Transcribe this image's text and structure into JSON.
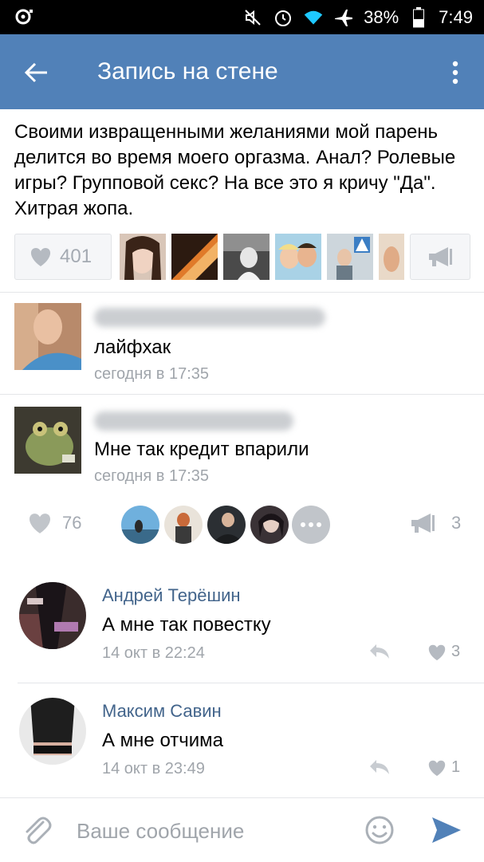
{
  "status_bar": {
    "battery": "38%",
    "time": "7:49"
  },
  "app_bar": {
    "title": "Запись на стене"
  },
  "post": {
    "text": "Своими извращенными желаниями мой парень делится во время моего оргазма. Анал? Ролевые игры? Групповой секс? На все это я кричу \"Да\". Хитрая жопа.",
    "likes_count": "401"
  },
  "comments": [
    {
      "text": "лайфхак",
      "time": "сегодня в 17:35"
    },
    {
      "text": "Мне так кредит впарили",
      "time": "сегодня в 17:35"
    }
  ],
  "comment_meta": {
    "likes_count": "76",
    "shares_count": "3"
  },
  "replies": [
    {
      "name": "Андрей Терёшин",
      "text": "А мне так повестку",
      "time": "14 окт в 22:24",
      "likes": "3"
    },
    {
      "name": "Максим Савин",
      "text": "А мне отчима",
      "time": "14 окт в 23:49",
      "likes": "1"
    }
  ],
  "composer": {
    "placeholder": "Ваше сообщение"
  },
  "colors": {
    "header": "#5181b8",
    "link_name": "#42648b",
    "muted": "#a0a5ab",
    "send": "#5181b8"
  }
}
